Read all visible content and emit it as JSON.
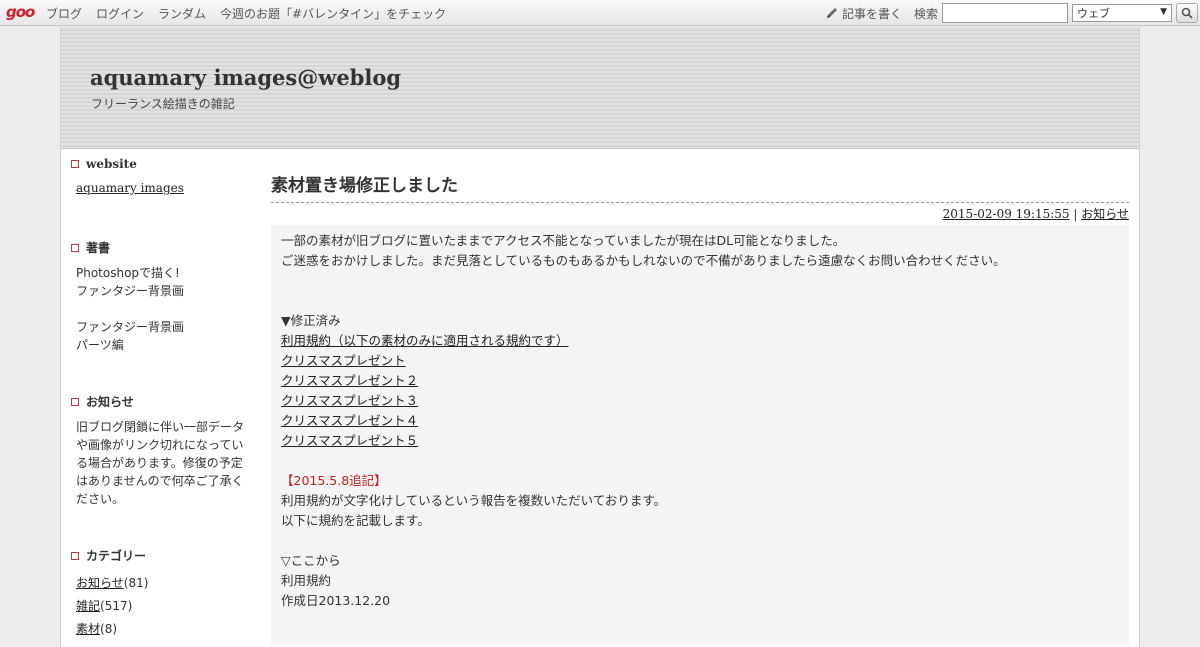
{
  "topbar": {
    "logo": "goo",
    "nav": [
      "ブログ",
      "ログイン",
      "ランダム",
      "今週のお題「#バレンタイン」をチェック"
    ],
    "write_label": "記事を書く",
    "search_label": "検索",
    "search_value": "",
    "search_scope": "ウェブ"
  },
  "header": {
    "title": "aquamary images@weblog",
    "tagline": "フリーランス絵描きの雑記"
  },
  "sidebar": {
    "website": {
      "title": "website",
      "link": "aquamary images"
    },
    "books": {
      "title": "著書",
      "lines": [
        "Photoshopで描く!",
        "ファンタジー背景画",
        "",
        "ファンタジー背景画",
        "パーツ編"
      ]
    },
    "notice": {
      "title": "お知らせ",
      "text": "旧ブログ閉鎖に伴い一部データや画像がリンク切れになっている場合があります。修復の予定はありませんので何卒ご了承ください。"
    },
    "categories": {
      "title": "カテゴリー",
      "items": [
        {
          "name": "お知らせ",
          "count": "(81)"
        },
        {
          "name": "雑記",
          "count": "(517)"
        },
        {
          "name": "素材",
          "count": "(8)"
        }
      ]
    }
  },
  "post": {
    "title": "素材置き場修正しました",
    "datetime": "2015-02-09 19:15:55",
    "separator": " | ",
    "category": "お知らせ",
    "para1": "一部の素材が旧ブログに置いたままでアクセス不能となっていましたが現在はDL可能となりました。",
    "para2": "ご迷惑をおかけしました。まだ見落としているものもあるかもしれないので不備がありましたら遠慮なくお問い合わせください。",
    "fixed_heading": "▼修正済み",
    "links": [
      "利用規約（以下の素材のみに適用される規約です）",
      "クリスマスプレゼント",
      "クリスマスプレゼント２",
      "クリスマスプレゼント３",
      "クリスマスプレゼント４",
      "クリスマスプレゼント５"
    ],
    "addendum_heading": "【2015.5.8追記】",
    "addendum1": "利用規約が文字化けしているという報告を複数いただいております。",
    "addendum2": "以下に規約を記載します。",
    "from_here": "▽ここから",
    "terms_title": "利用規約",
    "terms_date": "作成日2013.12.20"
  },
  "colors": {
    "accent": "#c0394b",
    "addendum": "#c81a1a"
  }
}
